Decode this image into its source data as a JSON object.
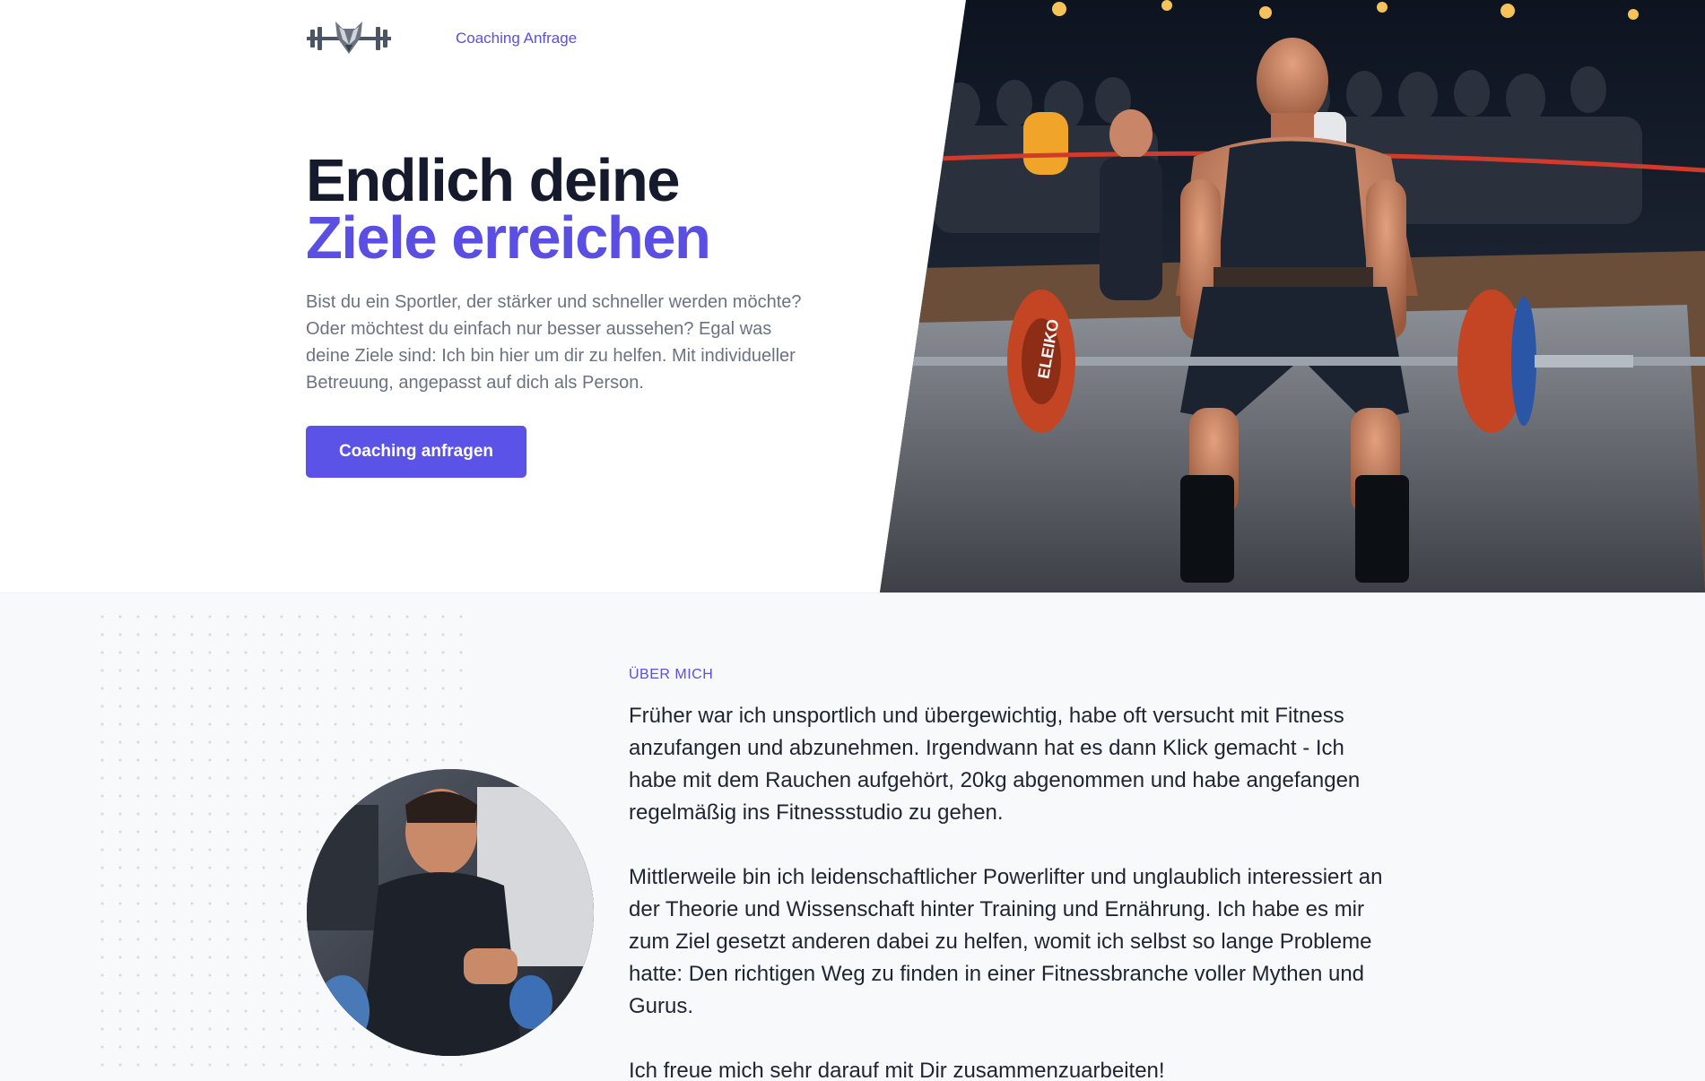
{
  "nav": {
    "logo_icon": "wolf-barbell-logo",
    "link_label": "Coaching Anfrage"
  },
  "hero": {
    "title_line1": "Endlich deine",
    "title_line2": "Ziele erreichen",
    "description": "Bist du ein Sportler, der stärker und schneller werden möchte? Oder möchtest du einfach nur besser aussehen? Egal was deine Ziele sind: Ich bin hier um dir zu helfen. Mit individueller Betreuung, angepasst auf dich als Person.",
    "cta_label": "Coaching anfragen",
    "image": "powerlifter-deadlift-photo",
    "plate_text": "ELEIKO"
  },
  "about": {
    "eyebrow": "Über mich",
    "paragraph1": "Früher war ich unsportlich und übergewichtig, habe oft versucht mit Fitness anzufangen und abzunehmen. Irgendwann hat es dann Klick gemacht - Ich habe mit dem Rauchen aufgehört, 20kg abgenommen und habe angefangen regelmäßig ins Fitnessstudio zu gehen.",
    "paragraph2": "Mittlerweile bin ich leidenschaftlicher Powerlifter und unglaublich interessiert an der Theorie und Wissenschaft hinter Training und Ernährung. Ich habe es mir zum Ziel gesetzt anderen dabei zu helfen, womit ich selbst so lange Probleme hatte: Den richtigen Weg zu finden in einer Fitnessbranche voller Mythen und Gurus.",
    "paragraph3": "Ich freue mich sehr darauf mit Dir zusammenzuarbeiten!",
    "avatar_image": "coach-portrait-photo"
  },
  "colors": {
    "accent": "#5a4ee3",
    "button": "#5b52e8",
    "heading": "#151a2c",
    "muted_text": "#6b7280",
    "section_bg": "#f8f9fb"
  }
}
